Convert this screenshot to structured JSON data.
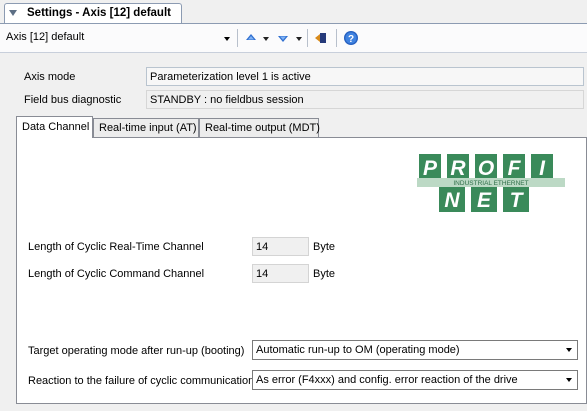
{
  "title_tab": {
    "label": "Settings - Axis [12] default"
  },
  "toolbar": {
    "axis_selector": "Axis [12] default",
    "icons": [
      "navigate-up-icon",
      "navigate-down-icon",
      "exit-icon",
      "help-icon"
    ]
  },
  "header": {
    "axis_mode_label": "Axis mode",
    "axis_mode_value": "Parameterization level 1 is active",
    "fieldbus_label": "Field bus diagnostic",
    "fieldbus_value": "STANDBY : no fieldbus session"
  },
  "tabs": [
    {
      "label": "Data Channel",
      "active": true
    },
    {
      "label": "Real-time input (AT)",
      "active": false
    },
    {
      "label": "Real-time output (MDT)",
      "active": false
    }
  ],
  "logo": {
    "top_letters": [
      "P",
      "R",
      "O",
      "F",
      "I"
    ],
    "bottom_letters": [
      "N",
      "E",
      "T"
    ],
    "band_text": "INDUSTRIAL ETHERNET",
    "color": "#3a8a5a"
  },
  "data_channel": {
    "rt_channel_label": "Length of Cyclic Real-Time Channel",
    "rt_channel_value": "14",
    "rt_channel_unit": "Byte",
    "cmd_channel_label": "Length of Cyclic Command Channel",
    "cmd_channel_value": "14",
    "cmd_channel_unit": "Byte",
    "target_mode_label": "Target operating mode after run-up (booting)",
    "target_mode_value": "Automatic run-up to OM (operating mode)",
    "failure_reaction_label": "Reaction to the failure of cyclic communication",
    "failure_reaction_value": "As error (F4xxx) and config. error reaction of the drive"
  }
}
